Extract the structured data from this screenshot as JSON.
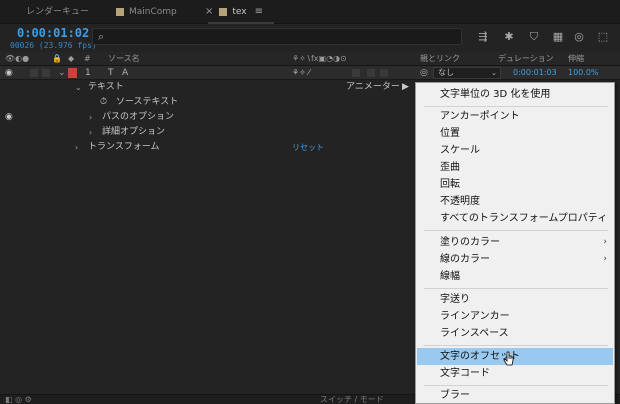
{
  "tabs": [
    {
      "label": "レンダーキュー"
    },
    {
      "label": "MainComp"
    },
    {
      "label": "tex",
      "close": "×",
      "menu": "≡"
    }
  ],
  "timeline": {
    "timecode": "0:00:01:02",
    "frames": "00026 (23.976 fps)",
    "search_placeholder": ""
  },
  "columns": {
    "number": "#",
    "source_name": "ソース名",
    "parent": "親とリンク",
    "duration": "デュレーション",
    "stretch": "伸縮"
  },
  "layer": {
    "number": "1",
    "name": "A",
    "parent_value": "なし",
    "duration": "0:00:01:03",
    "stretch": "100.0%"
  },
  "properties": {
    "text": "テキスト",
    "source_text": "ソーステキスト",
    "path_options": "パスのオプション",
    "more_options": "詳細オプション",
    "transform": "トランスフォーム",
    "reset": "リセット",
    "animator": "アニメーター :"
  },
  "bottom": {
    "switches": "スイッチ / モード"
  },
  "menu": {
    "items": [
      {
        "label": "文字単位の 3D 化を使用"
      },
      {
        "label": "アンカーポイント"
      },
      {
        "label": "位置"
      },
      {
        "label": "スケール"
      },
      {
        "label": "歪曲"
      },
      {
        "label": "回転"
      },
      {
        "label": "不透明度"
      },
      {
        "label": "すべてのトランスフォームプロパティ"
      },
      {
        "label": "塗りのカラー",
        "submenu": "›"
      },
      {
        "label": "線のカラー",
        "submenu": "›"
      },
      {
        "label": "線幅"
      },
      {
        "label": "字送り"
      },
      {
        "label": "ラインアンカー"
      },
      {
        "label": "ラインスペース"
      },
      {
        "label": "文字のオフセット"
      },
      {
        "label": "文字コード"
      },
      {
        "label": "ブラー"
      }
    ]
  },
  "colors": {
    "accent": "#3c9fe6",
    "highlight": "#99c9ef",
    "label_red": "#c4453c"
  }
}
